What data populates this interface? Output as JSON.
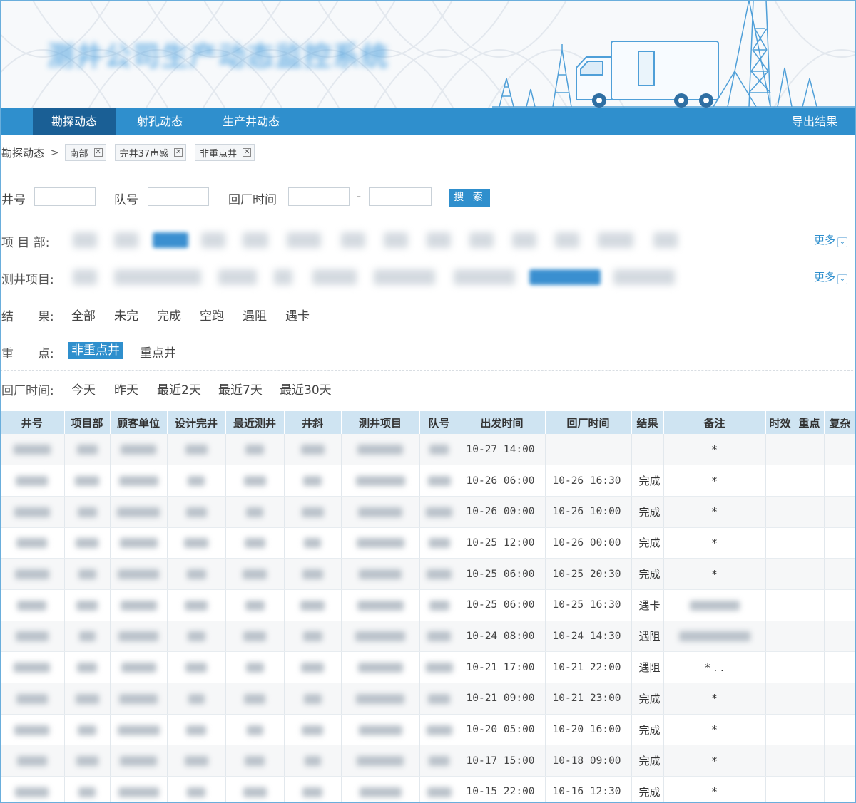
{
  "colors": {
    "accent": "#2f8fcd",
    "nav_active": "#1a5f95",
    "header_row": "#cfe4f2"
  },
  "header": {
    "title": "测井公司生产动态监控系统"
  },
  "nav": {
    "tabs": [
      {
        "label": "勘探动态",
        "active": true
      },
      {
        "label": "射孔动态",
        "active": false
      },
      {
        "label": "生产井动态",
        "active": false
      }
    ],
    "export_label": "导出结果"
  },
  "breadcrumb": {
    "root": "勘探动态",
    "separator": ">",
    "tags": [
      "南部",
      "完井37声感",
      "非重点井"
    ]
  },
  "search": {
    "well_label": "井号",
    "team_label": "队号",
    "return_time_label": "回厂时间",
    "range_dash": "-",
    "button_label": "搜 索",
    "well_value": "",
    "team_value": "",
    "time_from": "",
    "time_to": ""
  },
  "filters": {
    "department": {
      "label": "项 目 部:",
      "more": "更多"
    },
    "logging_item": {
      "label": "测井项目:",
      "more": "更多"
    },
    "result": {
      "label": "结　　果:",
      "options": [
        "全部",
        "未完",
        "完成",
        "空跑",
        "遇阻",
        "遇卡"
      ]
    },
    "key": {
      "label": "重　　点:",
      "options": [
        "非重点井",
        "重点井"
      ],
      "selected": "非重点井"
    },
    "return_time": {
      "label": "回厂时间:",
      "options": [
        "今天",
        "昨天",
        "最近2天",
        "最近7天",
        "最近30天"
      ]
    }
  },
  "table": {
    "columns": [
      "井号",
      "项目部",
      "顾客单位",
      "设计完井",
      "最近测井",
      "井斜",
      "测井项目",
      "队号",
      "出发时间",
      "回厂时间",
      "结果",
      "备注",
      "时效",
      "重点",
      "复杂"
    ],
    "rows": [
      {
        "depart": "10-27 14:00",
        "return": "",
        "result": "",
        "note": "*"
      },
      {
        "depart": "10-26 06:00",
        "return": "10-26 16:30",
        "result": "完成",
        "note": "*"
      },
      {
        "depart": "10-26 00:00",
        "return": "10-26 10:00",
        "result": "完成",
        "note": "*"
      },
      {
        "depart": "10-25 12:00",
        "return": "10-26 00:00",
        "result": "完成",
        "note": "*"
      },
      {
        "depart": "10-25 06:00",
        "return": "10-25 20:30",
        "result": "完成",
        "note": "*"
      },
      {
        "depart": "10-25 06:00",
        "return": "10-25 16:30",
        "result": "遇卡",
        "note": ""
      },
      {
        "depart": "10-24 08:00",
        "return": "10-24 14:30",
        "result": "遇阻",
        "note": ""
      },
      {
        "depart": "10-21 17:00",
        "return": "10-21 22:00",
        "result": "遇阻",
        "note": "* . ."
      },
      {
        "depart": "10-21 09:00",
        "return": "10-21 23:00",
        "result": "完成",
        "note": "*"
      },
      {
        "depart": "10-20 05:00",
        "return": "10-20 16:00",
        "result": "完成",
        "note": "*"
      },
      {
        "depart": "10-17 15:00",
        "return": "10-18 09:00",
        "result": "完成",
        "note": "*"
      },
      {
        "depart": "10-15 22:00",
        "return": "10-16 12:30",
        "result": "完成",
        "note": "*"
      }
    ]
  }
}
